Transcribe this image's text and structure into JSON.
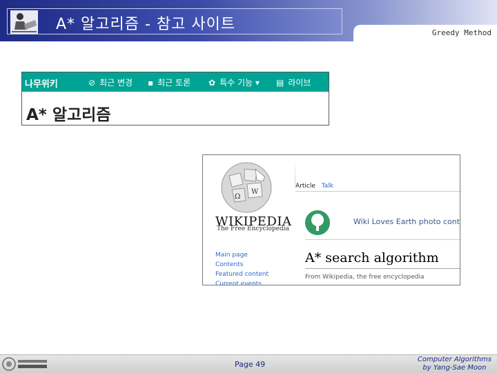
{
  "header": {
    "title": "A* 알고리즘 - 참고 사이트",
    "subtitle": "Greedy Method"
  },
  "namuwiki": {
    "logo": "나무위키",
    "nav": [
      {
        "icon": "compass-icon",
        "label": "최근 변경"
      },
      {
        "icon": "chat-icon",
        "label": "최근 토론"
      },
      {
        "icon": "gear-icon",
        "label": "특수 기능"
      },
      {
        "icon": "document-icon",
        "label": "라이브"
      }
    ],
    "article_title": "A* 알고리즘"
  },
  "wikipedia": {
    "wordmark": "WIKIPEDIA",
    "tagline": "The Free Encyclopedia",
    "sidebar_links": [
      "Main page",
      "Contents",
      "Featured content",
      "Current events"
    ],
    "tabs": {
      "article": "Article",
      "talk": "Talk"
    },
    "banner": "Wiki Loves Earth photo conte",
    "article_title": "A* search algorithm",
    "from_line": "From Wikipedia, the free encyclopedia"
  },
  "footer": {
    "page": "Page 49",
    "course_line1": "Computer Algorithms",
    "course_line2": "by Yang-Sae Moon"
  },
  "colors": {
    "header_blue": "#1f2c86",
    "namu_green": "#00a495",
    "link_blue": "#3366cc"
  }
}
